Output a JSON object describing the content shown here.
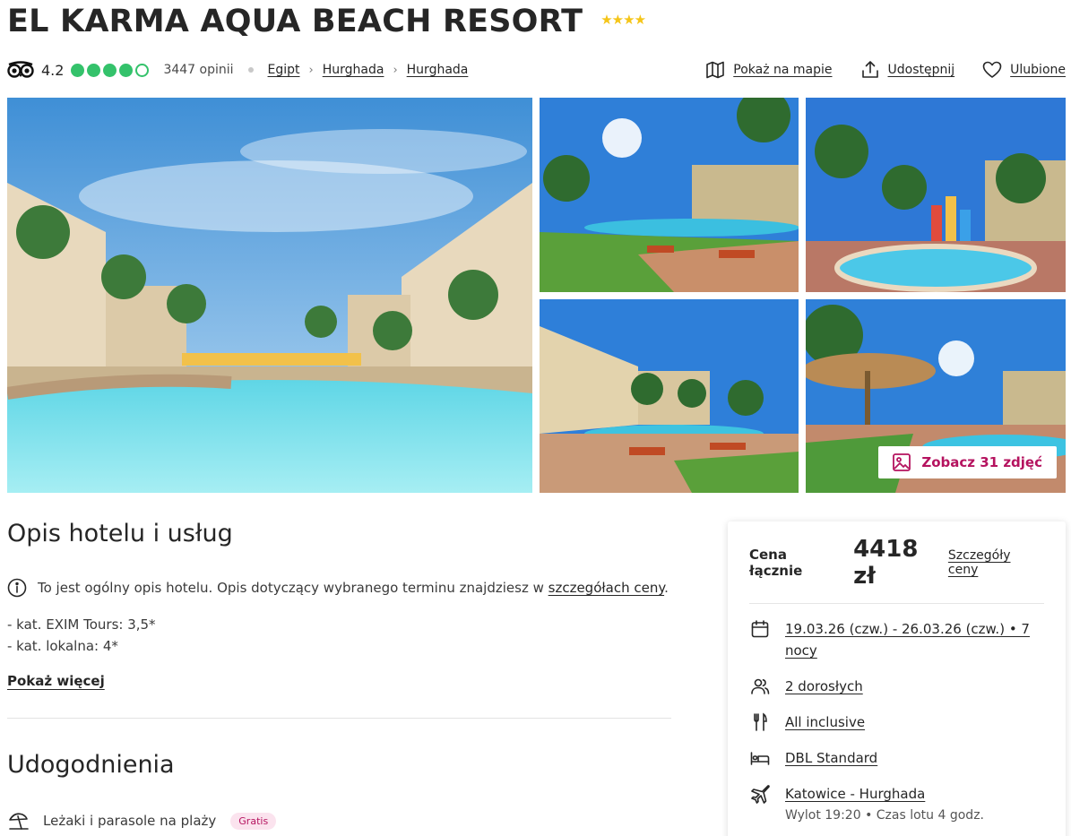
{
  "hotel": {
    "name": "EL KARMA AQUA BEACH RESORT",
    "stars": "★★★★"
  },
  "rating": {
    "score": "4.2",
    "bubbles_filled": 4,
    "bubbles_total": 5,
    "reviews": "3447 opinii"
  },
  "breadcrumb": [
    "Egipt",
    "Hurghada",
    "Hurghada"
  ],
  "actions": {
    "map": "Pokaż na mapie",
    "share": "Udostępnij",
    "favorite": "Ulubione"
  },
  "gallery": {
    "button": "Zobacz 31 zdjęć"
  },
  "description": {
    "title": "Opis hotelu i usług",
    "info_prefix": "To jest ogólny opis hotelu. Opis dotyczący wybranego terminu znajdziesz w ",
    "info_link": "szczegółach ceny",
    "info_suffix": ".",
    "categories": [
      "- kat. EXIM Tours: 3,5*",
      "- kat. lokalna: 4*"
    ],
    "show_more": "Pokaż więcej"
  },
  "amenities": {
    "title": "Udogodnienia",
    "items": [
      {
        "label": "Leżaki i parasole na plaży",
        "badge": "Gratis"
      }
    ]
  },
  "price_card": {
    "label": "Cena łącznie",
    "value": "4418 zł",
    "details_link": "Szczegóły ceny",
    "dates": "19.03.26 (czw.) - 26.03.26 (czw.) • 7 nocy",
    "guests": "2 dorosłych",
    "board": "All inclusive",
    "room": "DBL Standard",
    "flight": "Katowice - Hurghada",
    "flight_info": "Wylot 19:20 • Czas lotu 4 godz."
  },
  "colors": {
    "accent": "#b5135f",
    "rating_green": "#34c26b",
    "star_gold": "#f5c518"
  }
}
